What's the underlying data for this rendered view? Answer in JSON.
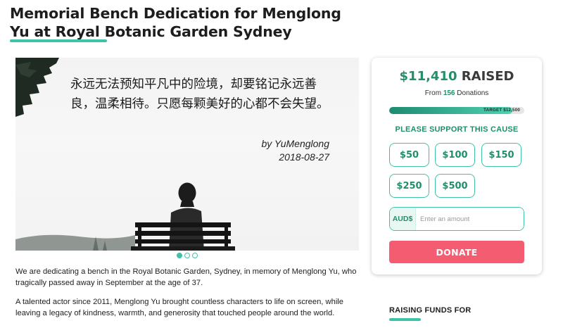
{
  "page": {
    "title": "Memorial Bench Dedication for Menglong Yu at Royal Botanic Garden Sydney"
  },
  "hero": {
    "quote": "永远无法预知平凡中的险境，却要铭记永远善良，温柔相待。只愿每颗美好的心都不会失望。",
    "author": "by YuMenglong",
    "date": "2018-08-27",
    "slide_count": 3,
    "active_slide": 1
  },
  "description": {
    "paragraph_1": "We are dedicating a bench in the Royal Botanic Garden, Sydney, in memory of Menglong Yu, who tragically passed away in September at the age of 37.",
    "paragraph_2": "A talented actor since 2011, Menglong Yu brought countless characters to life on screen, while leaving a legacy of kindness, warmth, and generosity that touched people around the world."
  },
  "donation": {
    "raised_amount": "$11,410",
    "raised_label": "RAISED",
    "from_prefix": "From",
    "donations_count": "156",
    "donations_label": "Donations",
    "progress_fraction": 0.913,
    "target_label": "TARGET $12,500",
    "support_label": "PLEASE SUPPORT THIS CAUSE",
    "amounts": [
      "$50",
      "$100",
      "$150",
      "$250",
      "$500"
    ],
    "currency": "AUD$",
    "amount_placeholder": "Enter an amount",
    "donate_label": "DONATE"
  },
  "sidebar": {
    "raising_funds_title": "RAISING FUNDS FOR"
  },
  "colors": {
    "accent": "#3ec3a8",
    "accent_dark": "#1f8f6c",
    "donate": "#f45d71"
  }
}
